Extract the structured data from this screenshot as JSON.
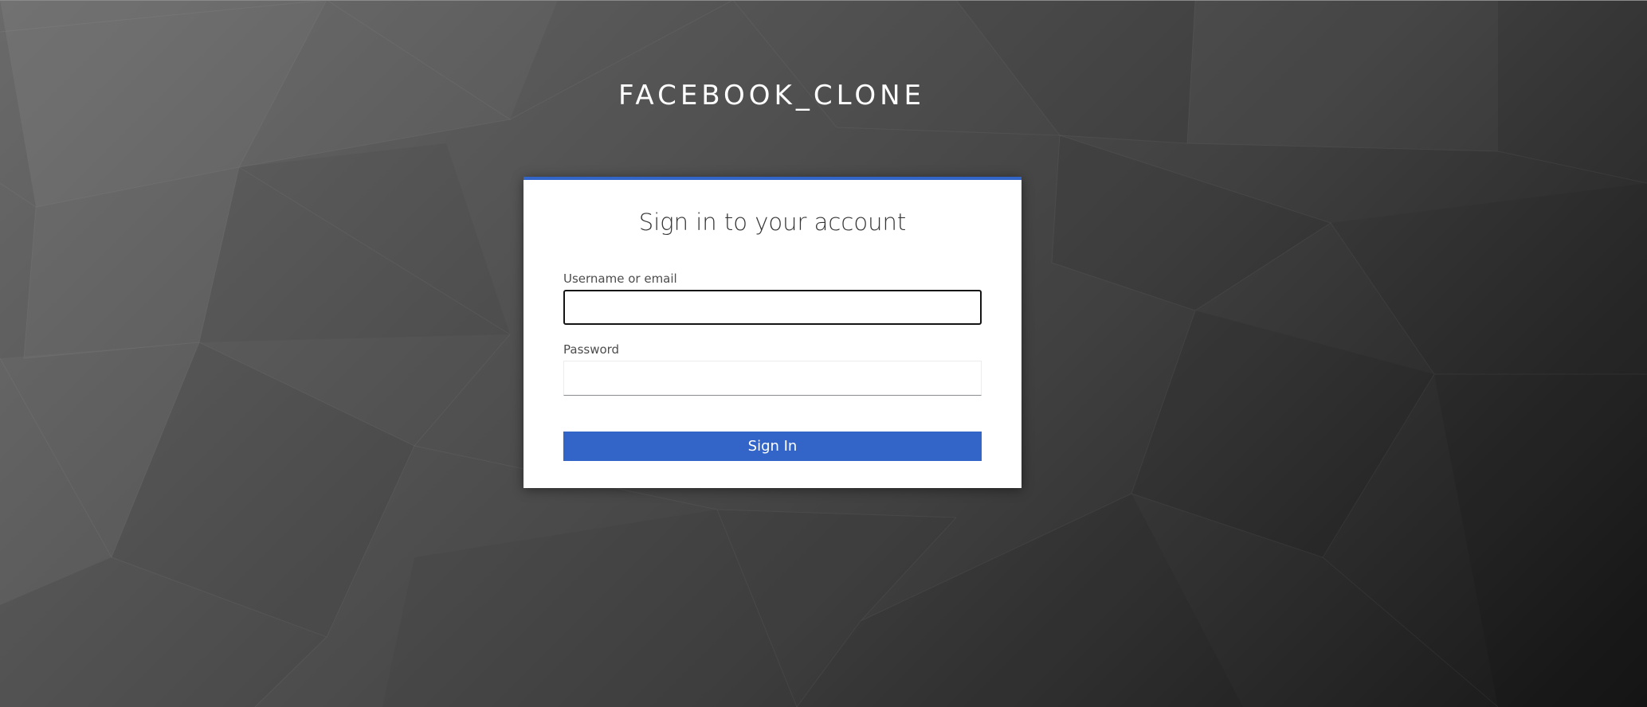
{
  "realm": {
    "title": "FACEBOOK_CLONE"
  },
  "login": {
    "heading": "Sign in to your account",
    "username_label": "Username or email",
    "username_value": "",
    "password_label": "Password",
    "password_value": "",
    "submit_label": "Sign In"
  },
  "colors": {
    "accent": "#3364c8",
    "card_background": "#ffffff",
    "heading_text": "#363636"
  }
}
